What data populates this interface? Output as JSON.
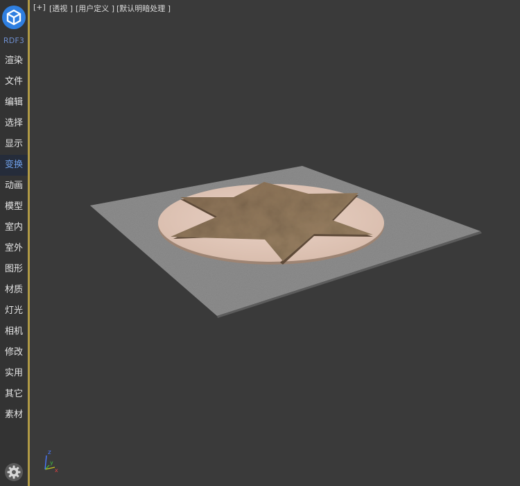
{
  "app": {
    "brand": "RDF3"
  },
  "sidebar": {
    "items": [
      {
        "label": "渲染",
        "active": false
      },
      {
        "label": "文件",
        "active": false
      },
      {
        "label": "编辑",
        "active": false
      },
      {
        "label": "选择",
        "active": false
      },
      {
        "label": "显示",
        "active": false
      },
      {
        "label": "变换",
        "active": true
      },
      {
        "label": "动画",
        "active": false
      },
      {
        "label": "模型",
        "active": false
      },
      {
        "label": "室内",
        "active": false
      },
      {
        "label": "室外",
        "active": false
      },
      {
        "label": "图形",
        "active": false
      },
      {
        "label": "材质",
        "active": false
      },
      {
        "label": "灯光",
        "active": false
      },
      {
        "label": "相机",
        "active": false
      },
      {
        "label": "修改",
        "active": false
      },
      {
        "label": "实用",
        "active": false
      },
      {
        "label": "其它",
        "active": false
      },
      {
        "label": "素材",
        "active": false
      }
    ],
    "active_color": "#6fa0ea",
    "accent_border": "#b09a45",
    "logo_icon": "cube-logo-icon",
    "settings_icon": "gear-icon"
  },
  "viewport": {
    "menu_plus": "[+]",
    "view_label": "[透视 ]",
    "mode_label": "[用户定义 ]",
    "shading_label": "[默认明暗处理 ]",
    "background_color": "#3a3a3a",
    "axis_labels": {
      "x": "x",
      "y": "y",
      "z": "z"
    }
  }
}
